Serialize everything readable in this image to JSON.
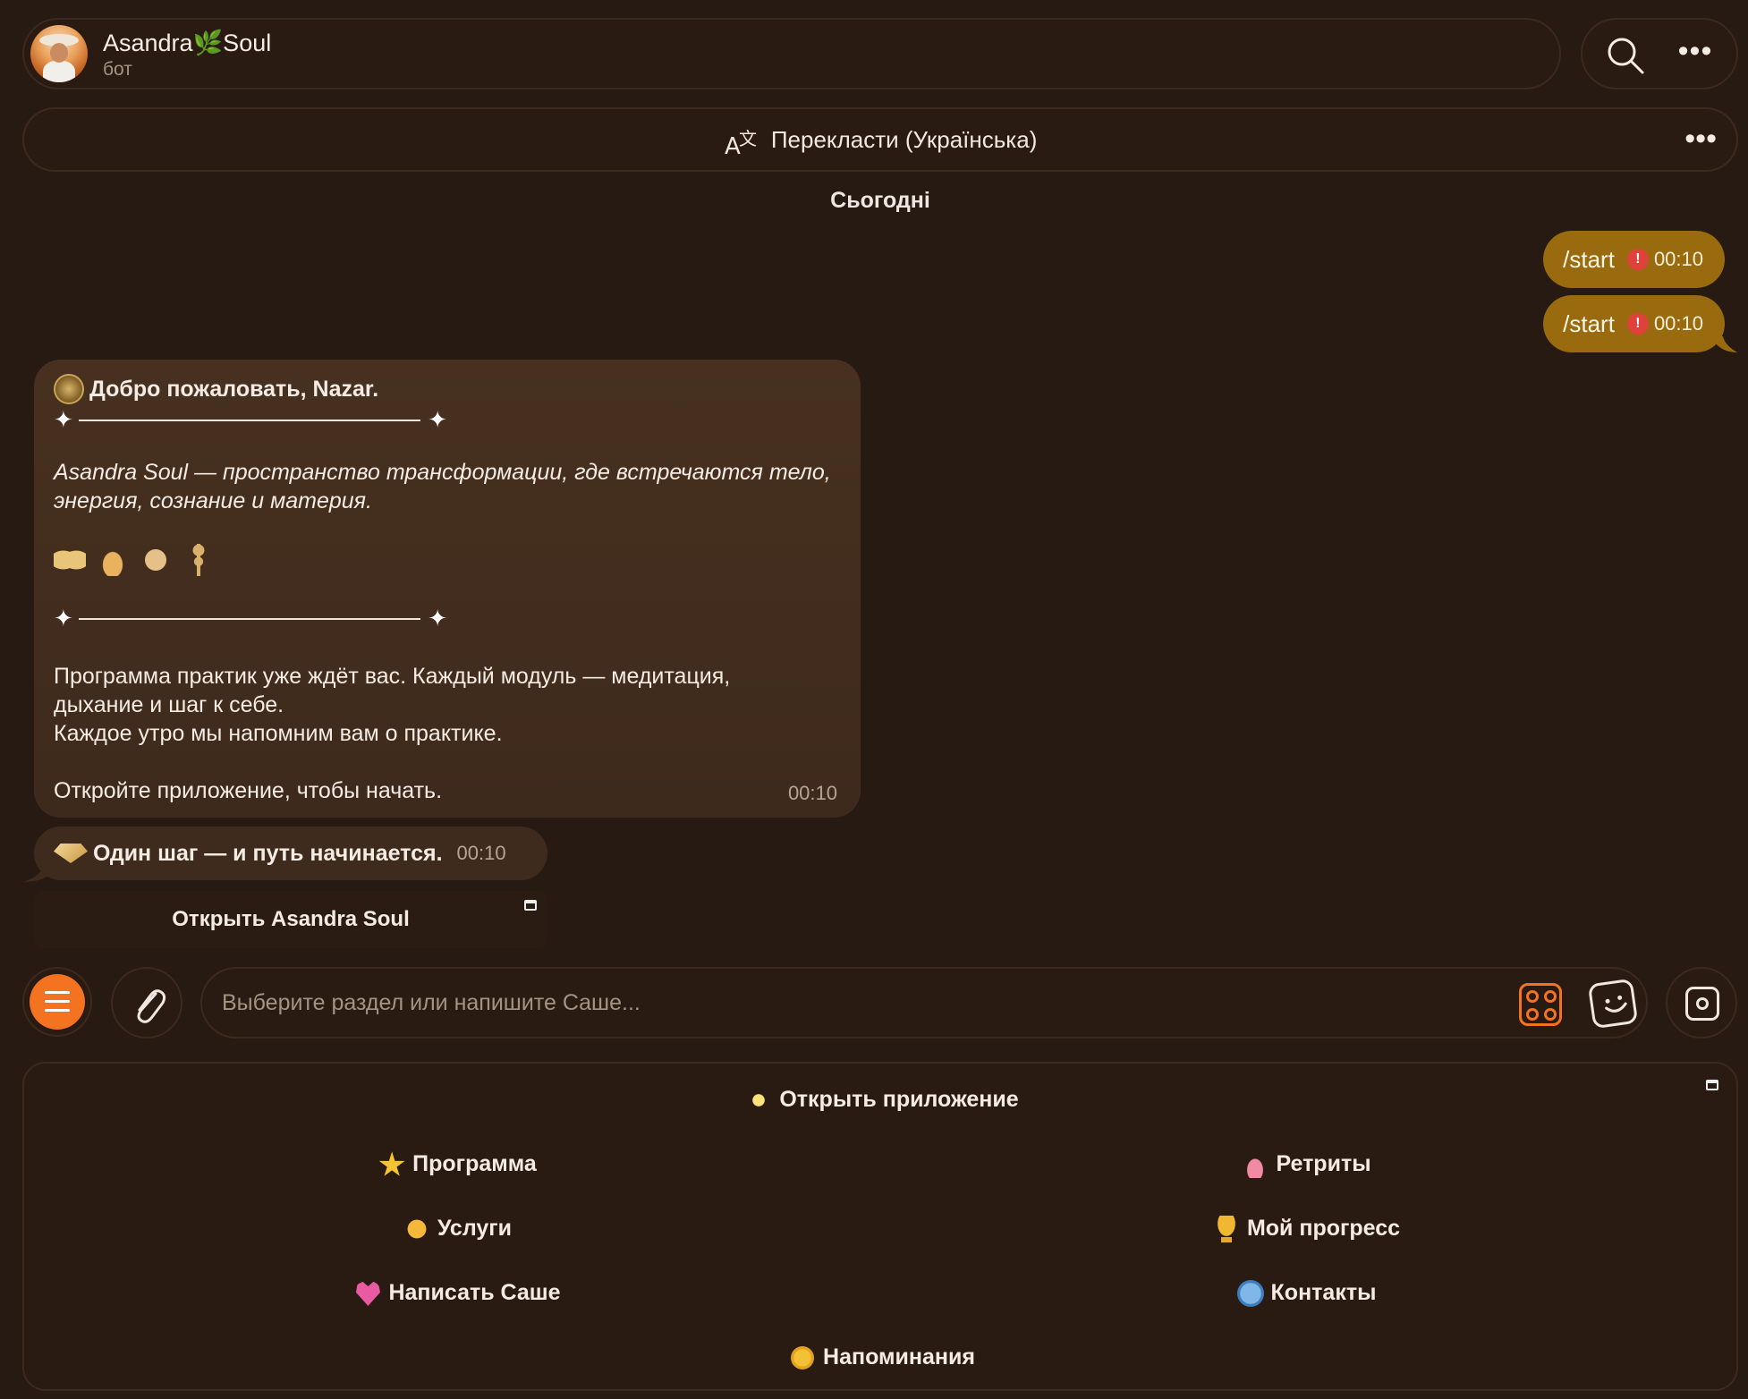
{
  "header": {
    "title": "Asandra🌿Soul",
    "subtitle": "бот"
  },
  "translate": {
    "label": "Перекласти (Українська)"
  },
  "date_divider": "Сьогодні",
  "outgoing": [
    {
      "text": "/start",
      "time": "00:10",
      "status": "error"
    },
    {
      "text": "/start",
      "time": "00:10",
      "status": "error"
    }
  ],
  "incoming": {
    "welcome": "Добро пожаловать, Nazar.",
    "intro": "Asandra Soul — пространство трансформации, где встречаются тело,",
    "intro2": "энергия, сознание и материя.",
    "p1": "Программа практик уже ждёт вас. Каждый модуль — медитация,",
    "p2": "дыхание и шаг к себе.",
    "p3": "Каждое утро мы напомним вам о практике.",
    "p4": "Откройте приложение, чтобы начать.",
    "time": "00:10"
  },
  "small_message": {
    "text": "Один шаг — и путь начинается.",
    "time": "00:10"
  },
  "inline_button": "Открыть Asandra Soul",
  "composer": {
    "placeholder": "Выберите раздел или напишите Саше..."
  },
  "keyboard": {
    "open_app": "Открыть приложение",
    "buttons": [
      {
        "label": "Программа",
        "icon": "star-icon"
      },
      {
        "label": "Ретриты",
        "icon": "lotus-icon"
      },
      {
        "label": "Услуги",
        "icon": "hands-icon"
      },
      {
        "label": "Мой прогресс",
        "icon": "trophy-icon"
      },
      {
        "label": "Написать Саше",
        "icon": "heart-icon"
      },
      {
        "label": "Контакты",
        "icon": "globe-icon"
      },
      {
        "label": "Напоминания",
        "icon": "sun-icon"
      }
    ]
  },
  "colors": {
    "background": "#271a12",
    "outgoing_bubble": "#9a6a0f",
    "incoming_bubble": "#47301f",
    "accent": "#f47320",
    "error": "#e0413b"
  }
}
